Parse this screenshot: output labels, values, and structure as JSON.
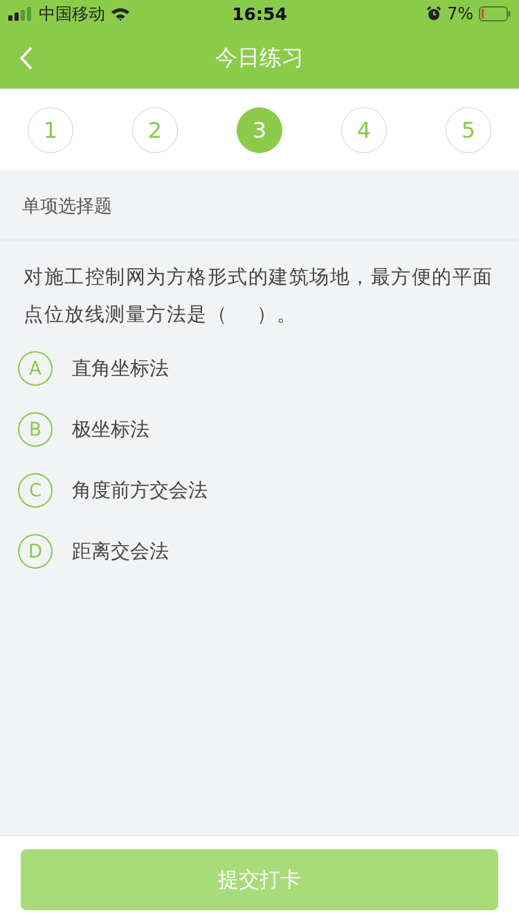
{
  "status_bar": {
    "carrier": "中国移动",
    "time": "16:54",
    "battery": "7%"
  },
  "header": {
    "title": "今日练习"
  },
  "steps": [
    {
      "label": "1",
      "selected": false
    },
    {
      "label": "2",
      "selected": false
    },
    {
      "label": "3",
      "selected": true
    },
    {
      "label": "4",
      "selected": false
    },
    {
      "label": "5",
      "selected": false
    }
  ],
  "question": {
    "type": "单项选择题",
    "text": "对施工控制网为方格形式的建筑场地，最方便的平面点位放线测量方法是（    ）。",
    "options": [
      {
        "letter": "A",
        "text": "直角坐标法",
        "selected": false
      },
      {
        "letter": "B",
        "text": "极坐标法",
        "selected": false
      },
      {
        "letter": "C",
        "text": "角度前方交会法",
        "selected": false
      },
      {
        "letter": "D",
        "text": "距离交会法",
        "selected": false
      }
    ]
  },
  "submit": {
    "label": "提交打卡",
    "disabled": true
  }
}
